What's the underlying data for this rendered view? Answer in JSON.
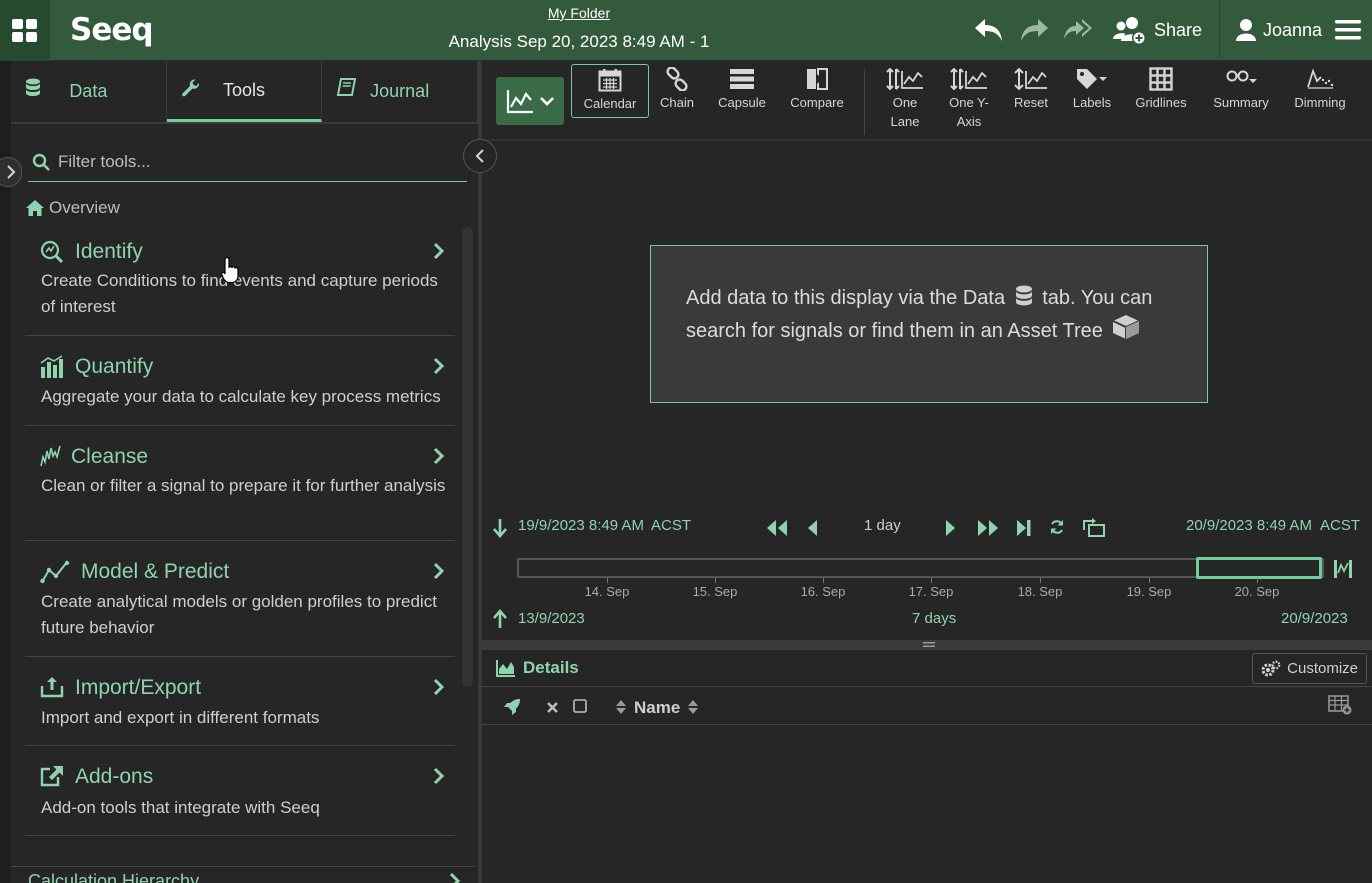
{
  "header": {
    "logo": "Seeq",
    "folder_link": "My Folder",
    "analysis_title": "Analysis Sep 20, 2023 8:49 AM - 1",
    "share_label": "Share",
    "user_name": "Joanna"
  },
  "left_panel": {
    "tabs": [
      {
        "label": "Data",
        "icon": "database-icon"
      },
      {
        "label": "Tools",
        "icon": "wrench-icon",
        "active": true
      },
      {
        "label": "Journal",
        "icon": "book-icon"
      }
    ],
    "filter_placeholder": "Filter tools...",
    "overview_label": "Overview",
    "tools": [
      {
        "name": "Identify",
        "description": "Create Conditions to find events and capture periods of interest",
        "icon": "identify-icon"
      },
      {
        "name": "Quantify",
        "description": "Aggregate your data to calculate key process metrics",
        "icon": "bar-chart-icon"
      },
      {
        "name": "Cleanse",
        "description": "Clean or filter a signal to prepare it for further analysis",
        "icon": "signal-icon"
      },
      {
        "name": "Model & Predict",
        "description": "Create analytical models or golden profiles to predict future behavior",
        "icon": "model-icon"
      },
      {
        "name": "Import/Export",
        "description": "Import and export in different formats",
        "icon": "upload-icon"
      },
      {
        "name": "Add-ons",
        "description": "Add-on tools that integrate with Seeq",
        "icon": "external-link-icon"
      }
    ],
    "calc_hierarchy_label": "Calculation Hierarchy"
  },
  "toolbar": {
    "calendar": "Calendar",
    "chain": "Chain",
    "capsule": "Capsule",
    "compare": "Compare",
    "one_lane_1": "One",
    "one_lane_2": "Lane",
    "one_y_axis_1": "One Y-",
    "one_y_axis_2": "Axis",
    "reset": "Reset",
    "labels": "Labels",
    "gridlines": "Gridlines",
    "summary": "Summary",
    "dimming": "Dimming"
  },
  "main": {
    "empty_line1_a": "Add data to this display via the Data",
    "empty_line1_b": "tab. You can",
    "empty_line2": "search for signals or find them in an Asset Tree"
  },
  "timebar": {
    "display_start": "19/9/2023 8:49 AM",
    "display_start_tz": "ACST",
    "duration": "1 day",
    "display_end": "20/9/2023 8:49 AM",
    "display_end_tz": "ACST",
    "investigate_start": "13/9/2023",
    "investigate_duration": "7 days",
    "investigate_end": "20/9/2023",
    "ticks": [
      "14. Sep",
      "15. Sep",
      "16. Sep",
      "17. Sep",
      "18. Sep",
      "19. Sep",
      "20. Sep"
    ]
  },
  "details": {
    "title": "Details",
    "customize_label": "Customize",
    "name_column": "Name"
  },
  "colors": {
    "brand_green": "#335a3c",
    "accent_mint": "#6fcf9b",
    "panel_bg": "#262626"
  }
}
